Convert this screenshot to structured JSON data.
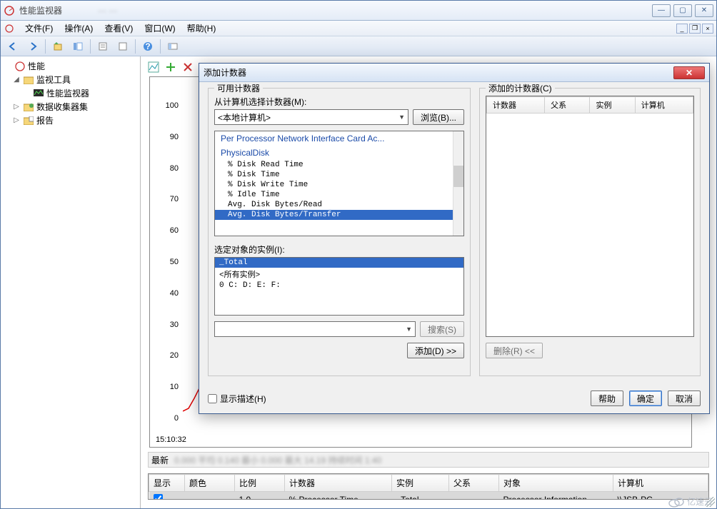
{
  "window": {
    "title": "性能监视器",
    "win_min": "—",
    "win_max": "▢",
    "win_close": "✕"
  },
  "menu": {
    "file": "文件(F)",
    "action": "操作(A)",
    "view": "查看(V)",
    "window": "窗口(W)",
    "help": "帮助(H)"
  },
  "tree": {
    "root": "性能",
    "tools": "监视工具",
    "perfmon": "性能监视器",
    "collectors": "数据收集器集",
    "reports": "报告"
  },
  "chart_data": {
    "type": "line",
    "ylim": [
      0,
      100
    ],
    "yticks": [
      0,
      10,
      20,
      30,
      40,
      50,
      60,
      70,
      80,
      90,
      100
    ],
    "x_start_label": "15:10:32",
    "series": [
      {
        "name": "% Processor Time",
        "color": "#e00000",
        "values": [
          2,
          3,
          6,
          10,
          8,
          4,
          3,
          2
        ]
      }
    ]
  },
  "stats": {
    "label": "最新"
  },
  "grid": {
    "headers": {
      "show": "显示",
      "color": "颜色",
      "scale": "比例",
      "counter": "计数器",
      "instance": "实例",
      "parent": "父系",
      "object": "对象",
      "computer": "计算机"
    },
    "row": {
      "checked": true,
      "scale": "1.0",
      "counter": "% Processor Time",
      "instance": "_Total",
      "parent": "---",
      "object": "Processor Information",
      "computer": "\\\\JSB-PC"
    }
  },
  "dialog": {
    "title": "添加计数器",
    "left_group": "可用计数器",
    "from_computer_label": "从计算机选择计数器(M):",
    "computer_value": "<本地计算机>",
    "browse_btn": "浏览(B)...",
    "cat1": "Per Processor Network Interface Card Ac...",
    "cat2": "PhysicalDisk",
    "counters": [
      "% Disk Read Time",
      "% Disk Time",
      "% Disk Write Time",
      "% Idle Time",
      "Avg. Disk Bytes/Read",
      "Avg. Disk Bytes/Transfer"
    ],
    "selected_counter_index": 5,
    "instances_label": "选定对象的实例(I):",
    "instances": [
      "_Total",
      "<所有实例>",
      "0 C: D: E: F:"
    ],
    "selected_instance_index": 0,
    "search_btn": "搜索(S)",
    "add_btn": "添加(D) >>",
    "right_group": "添加的计数器(C)",
    "added_headers": {
      "counter": "计数器",
      "parent": "父系",
      "instance": "实例",
      "computer": "计算机"
    },
    "remove_btn": "删除(R) <<",
    "show_desc": "显示描述(H)",
    "help_btn": "帮助",
    "ok_btn": "确定",
    "cancel_btn": "取消"
  },
  "watermark": "亿速云"
}
